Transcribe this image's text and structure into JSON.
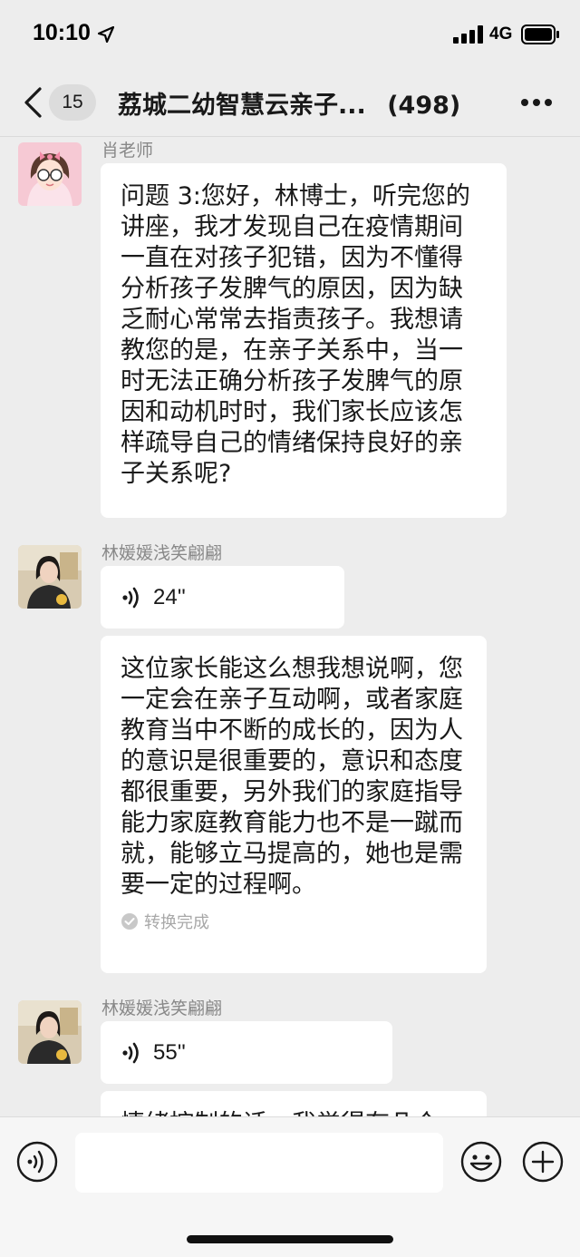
{
  "status_bar": {
    "time": "10:10",
    "network": "4G"
  },
  "nav": {
    "unread_count": "15",
    "title": "荔城二幼智慧云亲子...",
    "member_count": "(498)"
  },
  "messages": [
    {
      "sender": "肖老师",
      "avatar": "girl-cartoon-avatar",
      "text": "问题 3:您好，林博士，听完您的讲座，我才发现自己在疫情期间一直在对孩子犯错，因为不懂得分析孩子发脾气的原因，因为缺乏耐心常常去指责孩子。我想请教您的是，在亲子关系中，当一时无法正确分析孩子发脾气的原因和动机时时，我们家长应该怎样疏导自己的情绪保持良好的亲子关系呢?"
    },
    {
      "sender": "林媛媛浅笑翩翩",
      "avatar": "woman-photo-avatar",
      "voice_duration": "24''",
      "transcript": "这位家长能这么想我想说啊，您一定会在亲子互动啊，或者家庭教育当中不断的成长的，因为人的意识是很重要的，意识和态度都很重要，另外我们的家庭指导能力家庭教育能力也不是一蹴而就，能够立马提高的，她也是需要一定的过程啊。",
      "transcript_status": "转换完成"
    },
    {
      "sender": "林媛媛浅笑翩翩",
      "avatar": "woman-photo-avatar",
      "voice_duration": "55''",
      "transcript_partial": "情绪控制的话，我觉得有几个"
    }
  ],
  "input_bar": {
    "placeholder": ""
  },
  "colors": {
    "background": "#ededed",
    "bubble": "#ffffff",
    "text": "#191919",
    "name": "#888888"
  }
}
